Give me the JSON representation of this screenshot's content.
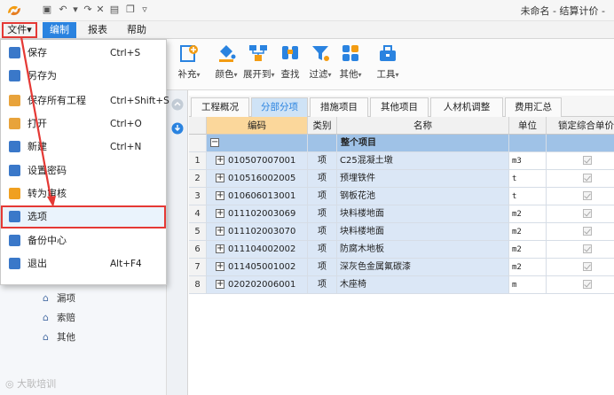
{
  "app": {
    "window_title": "未命名 - 结算计价 -"
  },
  "menubar": {
    "file": "文件▾",
    "edit": "编制",
    "report": "报表",
    "help": "帮助"
  },
  "ribbon": {
    "supplement": "补充",
    "color": "颜色",
    "expand_to": "展开到",
    "find": "查找",
    "filter": "过滤",
    "other": "其他",
    "tools": "工具"
  },
  "file_menu": {
    "items": [
      {
        "label": "保存",
        "shortcut": "Ctrl+S",
        "icon": "save-icon",
        "color": "#3a78c9"
      },
      {
        "label": "另存为",
        "shortcut": "",
        "icon": "save-as-icon",
        "color": "#3a78c9"
      },
      {
        "label": "保存所有工程",
        "shortcut": "Ctrl+Shift+S",
        "icon": "save-all-icon",
        "color": "#e8a33b"
      },
      {
        "label": "打开",
        "shortcut": "Ctrl+O",
        "icon": "open-icon",
        "color": "#e8a33b"
      },
      {
        "label": "新建",
        "shortcut": "Ctrl+N",
        "icon": "new-icon",
        "color": "#3a78c9"
      },
      {
        "label": "设置密码",
        "shortcut": "",
        "icon": "lock-icon",
        "color": "#3a78c9"
      },
      {
        "label": "转为审核",
        "shortcut": "",
        "icon": "convert-icon",
        "color": "#f0a020"
      },
      {
        "label": "选项",
        "shortcut": "",
        "icon": "options-icon",
        "color": "#3a78c9"
      },
      {
        "label": "备份中心",
        "shortcut": "",
        "icon": "backup-icon",
        "color": "#3a78c9"
      },
      {
        "label": "退出",
        "shortcut": "Alt+F4",
        "icon": "exit-icon",
        "color": "#3a78c9"
      }
    ]
  },
  "tree": {
    "items": [
      "漏项",
      "索赔",
      "其他"
    ]
  },
  "watermark": "大耿培训",
  "tabs": [
    "工程概况",
    "分部分项",
    "措施项目",
    "其他项目",
    "人材机调整",
    "费用汇总"
  ],
  "active_tab": 1,
  "grid": {
    "headers": {
      "code": "编码",
      "type": "类别",
      "name": "名称",
      "unit": "单位",
      "lock": "锁定综合单价"
    },
    "group_label": "整个项目",
    "group_toggle": "−",
    "rows": [
      {
        "num": "1",
        "code": "010507007001",
        "type": "项",
        "name": "C25混凝土墩",
        "unit": "m3"
      },
      {
        "num": "2",
        "code": "010516002005",
        "type": "项",
        "name": "预埋铁件",
        "unit": "t"
      },
      {
        "num": "3",
        "code": "010606013001",
        "type": "项",
        "name": "钢板花池",
        "unit": "t"
      },
      {
        "num": "4",
        "code": "011102003069",
        "type": "项",
        "name": "块料楼地面",
        "unit": "m2"
      },
      {
        "num": "5",
        "code": "011102003070",
        "type": "项",
        "name": "块料楼地面",
        "unit": "m2"
      },
      {
        "num": "6",
        "code": "011104002002",
        "type": "项",
        "name": "防腐木地板",
        "unit": "m2"
      },
      {
        "num": "7",
        "code": "011405001002",
        "type": "项",
        "name": "深灰色金属氟碳漆",
        "unit": "m2"
      },
      {
        "num": "8",
        "code": "020202006001",
        "type": "项",
        "name": "木座椅",
        "unit": "m"
      }
    ],
    "row_toggle": "+"
  },
  "colors": {
    "accent": "#2a83e0",
    "highlight_border": "#e53935",
    "header_code": "#fbd79b",
    "group_row": "#9fc2e7"
  }
}
